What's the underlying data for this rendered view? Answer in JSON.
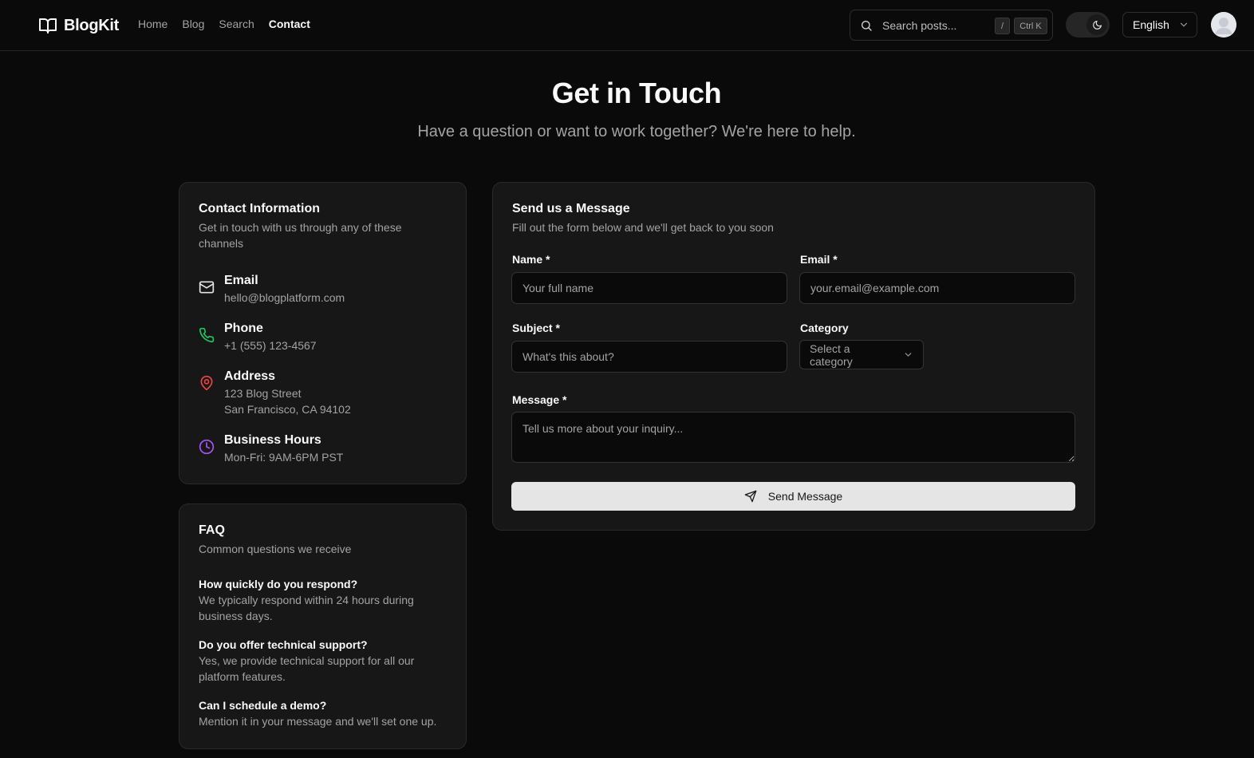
{
  "app": {
    "name": "BlogKit"
  },
  "nav": {
    "items": [
      {
        "label": "Home",
        "active": false
      },
      {
        "label": "Blog",
        "active": false
      },
      {
        "label": "Search",
        "active": false
      },
      {
        "label": "Contact",
        "active": true
      }
    ]
  },
  "search": {
    "placeholder": "Search posts...",
    "shortcut_slash": "/",
    "shortcut_ctrl": "Ctrl K"
  },
  "theme": {
    "mode": "dark",
    "icon": "moon-icon"
  },
  "language": {
    "selected": "English"
  },
  "hero": {
    "title": "Get in Touch",
    "subtitle": "Have a question or want to work together? We're here to help."
  },
  "contact_info": {
    "title": "Contact Information",
    "description": "Get in touch with us through any of these channels",
    "items": [
      {
        "icon": "mail-icon",
        "label": "Email",
        "value": "hello@blogplatform.com",
        "color": "#e5e5e5"
      },
      {
        "icon": "phone-icon",
        "label": "Phone",
        "value": "+1 (555) 123-4567",
        "color": "#22c55e"
      },
      {
        "icon": "map-pin-icon",
        "label": "Address",
        "value": "123 Blog Street",
        "value2": "San Francisco, CA 94102",
        "color": "#ef4444"
      },
      {
        "icon": "clock-icon",
        "label": "Business Hours",
        "value": "Mon-Fri: 9AM-6PM PST",
        "color": "#a855f7"
      }
    ]
  },
  "faq": {
    "title": "FAQ",
    "description": "Common questions we receive",
    "items": [
      {
        "question": "How quickly do you respond?",
        "answer": "We typically respond within 24 hours during business days."
      },
      {
        "question": "Do you offer technical support?",
        "answer": "Yes, we provide technical support for all our platform features."
      },
      {
        "question": "Can I schedule a demo?",
        "answer": "Mention it in your message and we'll set one up."
      }
    ]
  },
  "form": {
    "title": "Send us a Message",
    "description": "Fill out the form below and we'll get back to you soon",
    "name": {
      "label": "Name *",
      "placeholder": "Your full name",
      "value": ""
    },
    "email": {
      "label": "Email *",
      "placeholder": "your.email@example.com",
      "value": ""
    },
    "subject": {
      "label": "Subject *",
      "placeholder": "What's this about?",
      "value": ""
    },
    "category": {
      "label": "Category",
      "selected": "Select a category"
    },
    "message": {
      "label": "Message *",
      "placeholder": "Tell us more about your inquiry...",
      "value": ""
    },
    "submit_label": "Send Message"
  }
}
